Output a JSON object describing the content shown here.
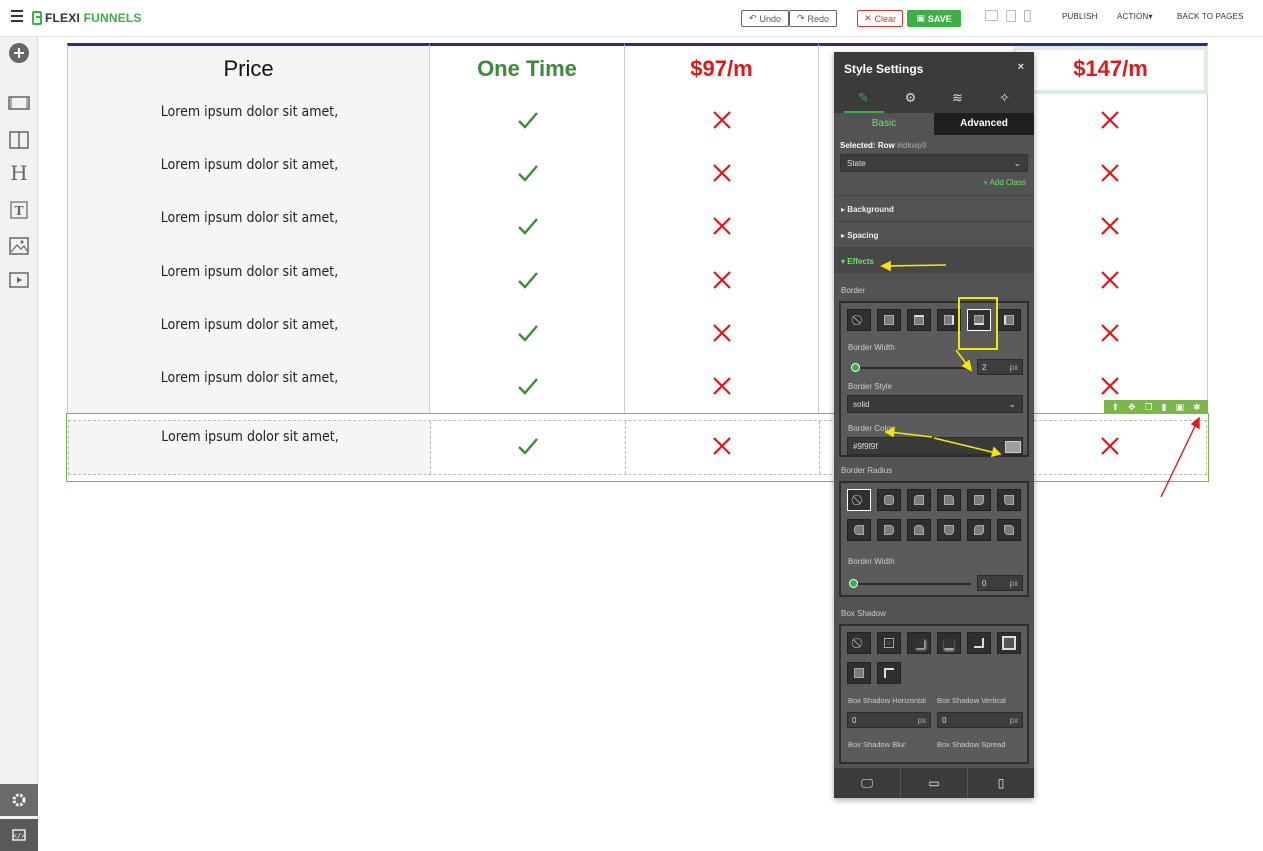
{
  "app": {
    "brand_left": "FLEXI",
    "brand_right": "FUNNELS"
  },
  "toolbar": {
    "undo": "Undo",
    "redo": "Redo",
    "clear": "Clear",
    "save": "SAVE",
    "publish": "PUBLISH",
    "action": "ACTION",
    "back": "BACK TO PAGES"
  },
  "sidebar": {
    "items": [
      "add-icon",
      "section-icon",
      "columns-icon",
      "heading-icon",
      "text-icon",
      "image-icon",
      "video-icon"
    ],
    "bottom": [
      "settings-icon",
      "code-icon"
    ]
  },
  "pricing": {
    "headers": [
      "Price",
      "One Time",
      "$97/m",
      "",
      "$147/m"
    ],
    "features": [
      "Lorem ipsum dolor sit amet,",
      "Lorem ipsum dolor sit amet,",
      "Lorem ipsum dolor sit amet,",
      "Lorem ipsum dolor sit amet,",
      "Lorem ipsum dolor sit amet,",
      "Lorem ipsum dolor sit amet,"
    ],
    "selected_row_feature": "Lorem ipsum dolor sit amet,",
    "check_color": "#3a8c3a",
    "cross_color": "#e01818"
  },
  "panel": {
    "title": "Style Settings",
    "close": "×",
    "tab_basic": "Basic",
    "tab_advanced": "Advanced",
    "selected_label": "Selected:",
    "selected_type": "Row",
    "selected_id": "#idkwp9",
    "state_placeholder": "State",
    "add_class": "Add Class",
    "sections": {
      "background": "Background",
      "spacing": "Spacing",
      "effects": "Effects"
    },
    "border": {
      "label": "Border",
      "width_label": "Border Width",
      "width_value": "2",
      "unit": "px",
      "style_label": "Border Style",
      "style_value": "solid",
      "color_label": "Border Color",
      "color_value": "#9f9f9f"
    },
    "radius": {
      "label": "Border Radius",
      "width_label": "Border Width",
      "width_value": "0",
      "unit": "px"
    },
    "shadow": {
      "label": "Box Shadow",
      "horizontal_label": "Box Shadow Horizontal",
      "vertical_label": "Box Shadow Vertical",
      "horizontal_value": "0",
      "vertical_value": "0",
      "unit": "px",
      "blur_label": "Box Shadow Blur",
      "spread_label": "Box Shadow Spread"
    }
  },
  "colors": {
    "accent": "#3cb043",
    "header_bar": "#2e2a8c",
    "selection": "#7ab648",
    "annotation_yellow": "#f5e800",
    "annotation_red": "#e01818"
  }
}
